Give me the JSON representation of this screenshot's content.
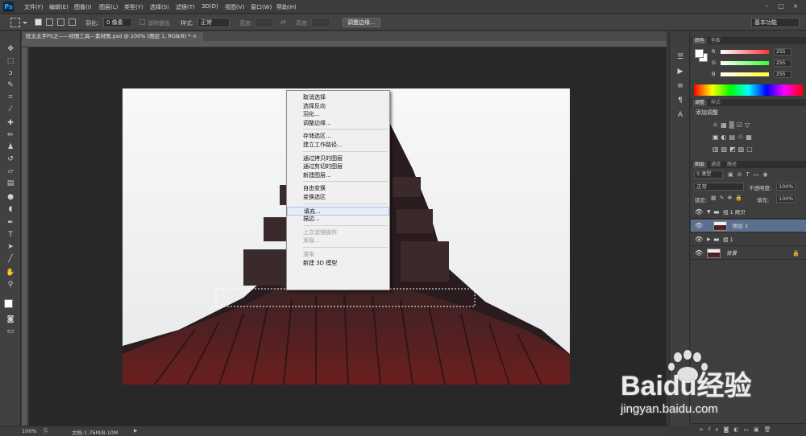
{
  "app": {
    "logo": "Ps"
  },
  "menubar": {
    "items": [
      "文件(F)",
      "编辑(E)",
      "图像(I)",
      "图层(L)",
      "类型(Y)",
      "选择(S)",
      "滤镜(T)",
      "3D(D)",
      "视图(V)",
      "窗口(W)",
      "帮助(H)"
    ],
    "window_controls": [
      "–",
      "□",
      "×"
    ]
  },
  "options_bar": {
    "feather_label": "羽化:",
    "feather_value": "0 像素",
    "antialias_label": "消除锯齿",
    "style_label": "样式:",
    "style_value": "正常",
    "width_label": "宽度:",
    "height_label": "高度:",
    "refine_button": "调整边缘...",
    "workspace_value": "基本功能"
  },
  "document": {
    "tab_title": "程太太字PS之——修图工具—素材图.psd @ 100% (图层 1, RGB/8) *",
    "tab_close": "×",
    "zoom": "100%",
    "doc_info": "文档:1.76M/8.10M"
  },
  "context_menu": {
    "groups": [
      [
        {
          "label": "取消选择",
          "enabled": true
        },
        {
          "label": "选择反向",
          "enabled": true
        },
        {
          "label": "羽化...",
          "enabled": true
        },
        {
          "label": "调整边缘...",
          "enabled": true
        }
      ],
      [
        {
          "label": "存储选区...",
          "enabled": true
        },
        {
          "label": "建立工作路径...",
          "enabled": true
        }
      ],
      [
        {
          "label": "通过拷贝的图层",
          "enabled": true
        },
        {
          "label": "通过剪切的图层",
          "enabled": true
        },
        {
          "label": "新建图层...",
          "enabled": true
        }
      ],
      [
        {
          "label": "自由变换",
          "enabled": true
        },
        {
          "label": "变换选区",
          "enabled": true
        }
      ],
      [
        {
          "label": "填充...",
          "enabled": true,
          "highlighted": true
        },
        {
          "label": "描边...",
          "enabled": true
        }
      ],
      [
        {
          "label": "上次滤镜操作",
          "enabled": false
        },
        {
          "label": "渐隐...",
          "enabled": false
        }
      ],
      [
        {
          "label": "渲染",
          "enabled": false
        },
        {
          "label": "新建 3D 模型",
          "enabled": true
        }
      ]
    ]
  },
  "color_panel": {
    "tabs": [
      "颜色",
      "色板"
    ],
    "channels": [
      {
        "label": "R",
        "value": "255",
        "gradient_end": "#ff3333"
      },
      {
        "label": "G",
        "value": "255",
        "gradient_end": "#33ff33"
      },
      {
        "label": "B",
        "value": "255",
        "gradient_end": "#ffff33"
      }
    ]
  },
  "adjustments_panel": {
    "tabs": [
      "调整",
      "样式"
    ],
    "title": "添加调整"
  },
  "layers_panel": {
    "tabs": [
      "图层",
      "通道",
      "路径"
    ],
    "filter_kind": "类型",
    "blend_mode": "正常",
    "opacity_label": "不透明度:",
    "opacity_value": "100%",
    "lock_label": "锁定:",
    "fill_label": "填充:",
    "fill_value": "100%",
    "layers": [
      {
        "name": "组 1 拷贝",
        "type": "group",
        "expanded": true,
        "selected": false
      },
      {
        "name": "图层 1",
        "type": "layer",
        "selected": true
      },
      {
        "name": "组 1",
        "type": "group",
        "expanded": false,
        "selected": false
      },
      {
        "name": "背景",
        "type": "background",
        "selected": false,
        "locked": true
      }
    ]
  },
  "watermark": {
    "brand": "Baidu经验",
    "url": "jingyan.baidu.com"
  },
  "colors": {
    "accent": "#31a8ff",
    "selected_layer": "#5b6f8f",
    "menu_highlight": "#e3ecf7"
  }
}
